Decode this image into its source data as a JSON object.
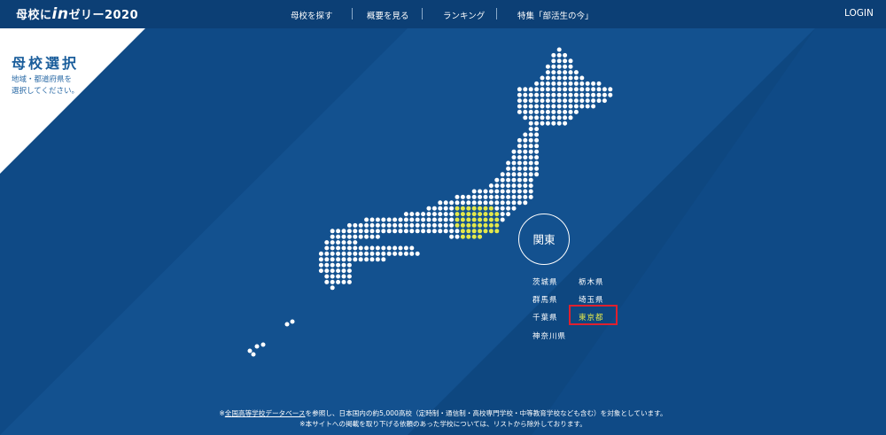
{
  "colors": {
    "bg": "#0f4a86",
    "header": "#0c3f75",
    "dot": "#ffffff",
    "highlight": "#e4e84a",
    "box": "#e0202e"
  },
  "header": {
    "logo_prefix": "母校に",
    "logo_in": "in",
    "logo_suffix": "ゼリー2020",
    "nav": [
      "母校を探す",
      "概要を見る",
      "ランキング",
      "特集「部活生の今」"
    ],
    "login": "LOGIN"
  },
  "corner": {
    "title": "母校選択",
    "sub1": "地域・都道府県を",
    "sub2": "選択してください。"
  },
  "region": {
    "label": "関東"
  },
  "prefectures": [
    {
      "name": "茨城県",
      "active": false
    },
    {
      "name": "栃木県",
      "active": false
    },
    {
      "name": "群馬県",
      "active": false
    },
    {
      "name": "埼玉県",
      "active": false
    },
    {
      "name": "千葉県",
      "active": false
    },
    {
      "name": "東京都",
      "active": true
    },
    {
      "name": "神奈川県",
      "active": false
    }
  ],
  "footer": {
    "mark": "※",
    "link": "全国高等学校データベース",
    "line1_rest": "を参照し、日本国内の約5,000高校（定時制・通信制・高校専門学校・中等教育学校なども含む）を対象としています。",
    "line2": "※本サイトへの掲載を取り下げる依頼のあった学校については、リストから除外しております。"
  }
}
